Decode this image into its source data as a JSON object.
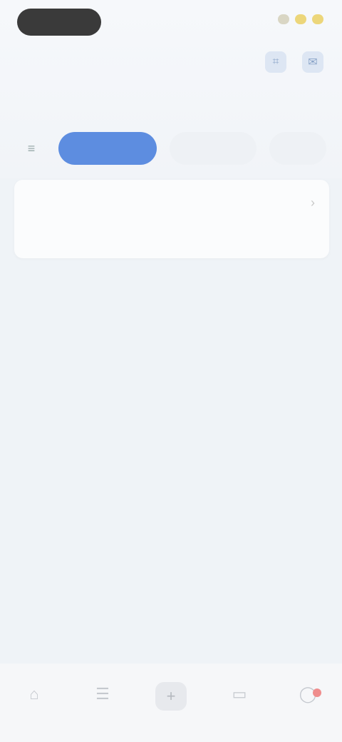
{
  "header": {
    "title": "",
    "top_actions": [
      "scan-icon",
      "message-icon"
    ],
    "sub_row": [
      "",
      ""
    ]
  },
  "filters": {
    "lead_icon": "filter-icon",
    "chips": [
      {
        "label": "",
        "active": true
      },
      {
        "label": "",
        "active": false
      },
      {
        "label": "",
        "active": false
      }
    ]
  },
  "card": {
    "name_line1": "",
    "name_line2": "",
    "value": ""
  },
  "bottom_nav": {
    "items": [
      {
        "label": "",
        "icon": "home-icon"
      },
      {
        "label": "",
        "icon": "list-icon"
      },
      {
        "label": "",
        "icon": "add-icon"
      },
      {
        "label": "",
        "icon": "wallet-icon"
      },
      {
        "label": "",
        "icon": "user-icon"
      }
    ]
  },
  "colors": {
    "accent": "#5d8de0",
    "background": "#eff3f7",
    "status_pill": "#3a3a3a",
    "badge": "#ef8d8d"
  }
}
